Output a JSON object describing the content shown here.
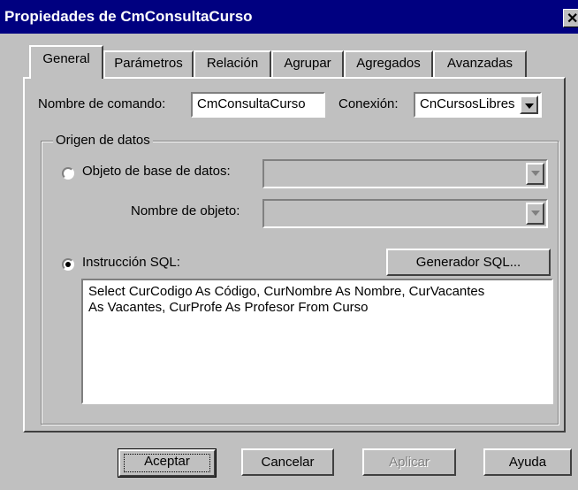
{
  "dialog": {
    "title": "Propiedades de CmConsultaCurso",
    "close_glyph": "✕"
  },
  "tabs": [
    {
      "label": "General",
      "active": true
    },
    {
      "label": "Parámetros",
      "active": false
    },
    {
      "label": "Relación",
      "active": false
    },
    {
      "label": "Agrupar",
      "active": false
    },
    {
      "label": "Agregados",
      "active": false
    },
    {
      "label": "Avanzadas",
      "active": false
    }
  ],
  "general": {
    "command_name_label": "Nombre de comando:",
    "command_name_value": "CmConsultaCurso",
    "connection_label": "Conexión:",
    "connection_value": "CnCursosLibres",
    "datasource_group_title": "Origen de datos",
    "db_object_label": "Objeto de base de datos:",
    "db_object_value": "",
    "object_name_label": "Nombre de objeto:",
    "object_name_value": "",
    "sql_label": "Instrucción SQL:",
    "sql_builder_button": "Generador SQL...",
    "sql_text": "Select CurCodigo As Código, CurNombre As Nombre, CurVacantes\nAs Vacantes, CurProfe As Profesor From Curso",
    "selected_source": "sql"
  },
  "buttons": {
    "accept": "Aceptar",
    "cancel": "Cancelar",
    "apply": "Aplicar",
    "help": "Ayuda"
  },
  "colors": {
    "titlebar": "#000080",
    "face": "#c0c0c0",
    "disabled_text": "#808080"
  }
}
